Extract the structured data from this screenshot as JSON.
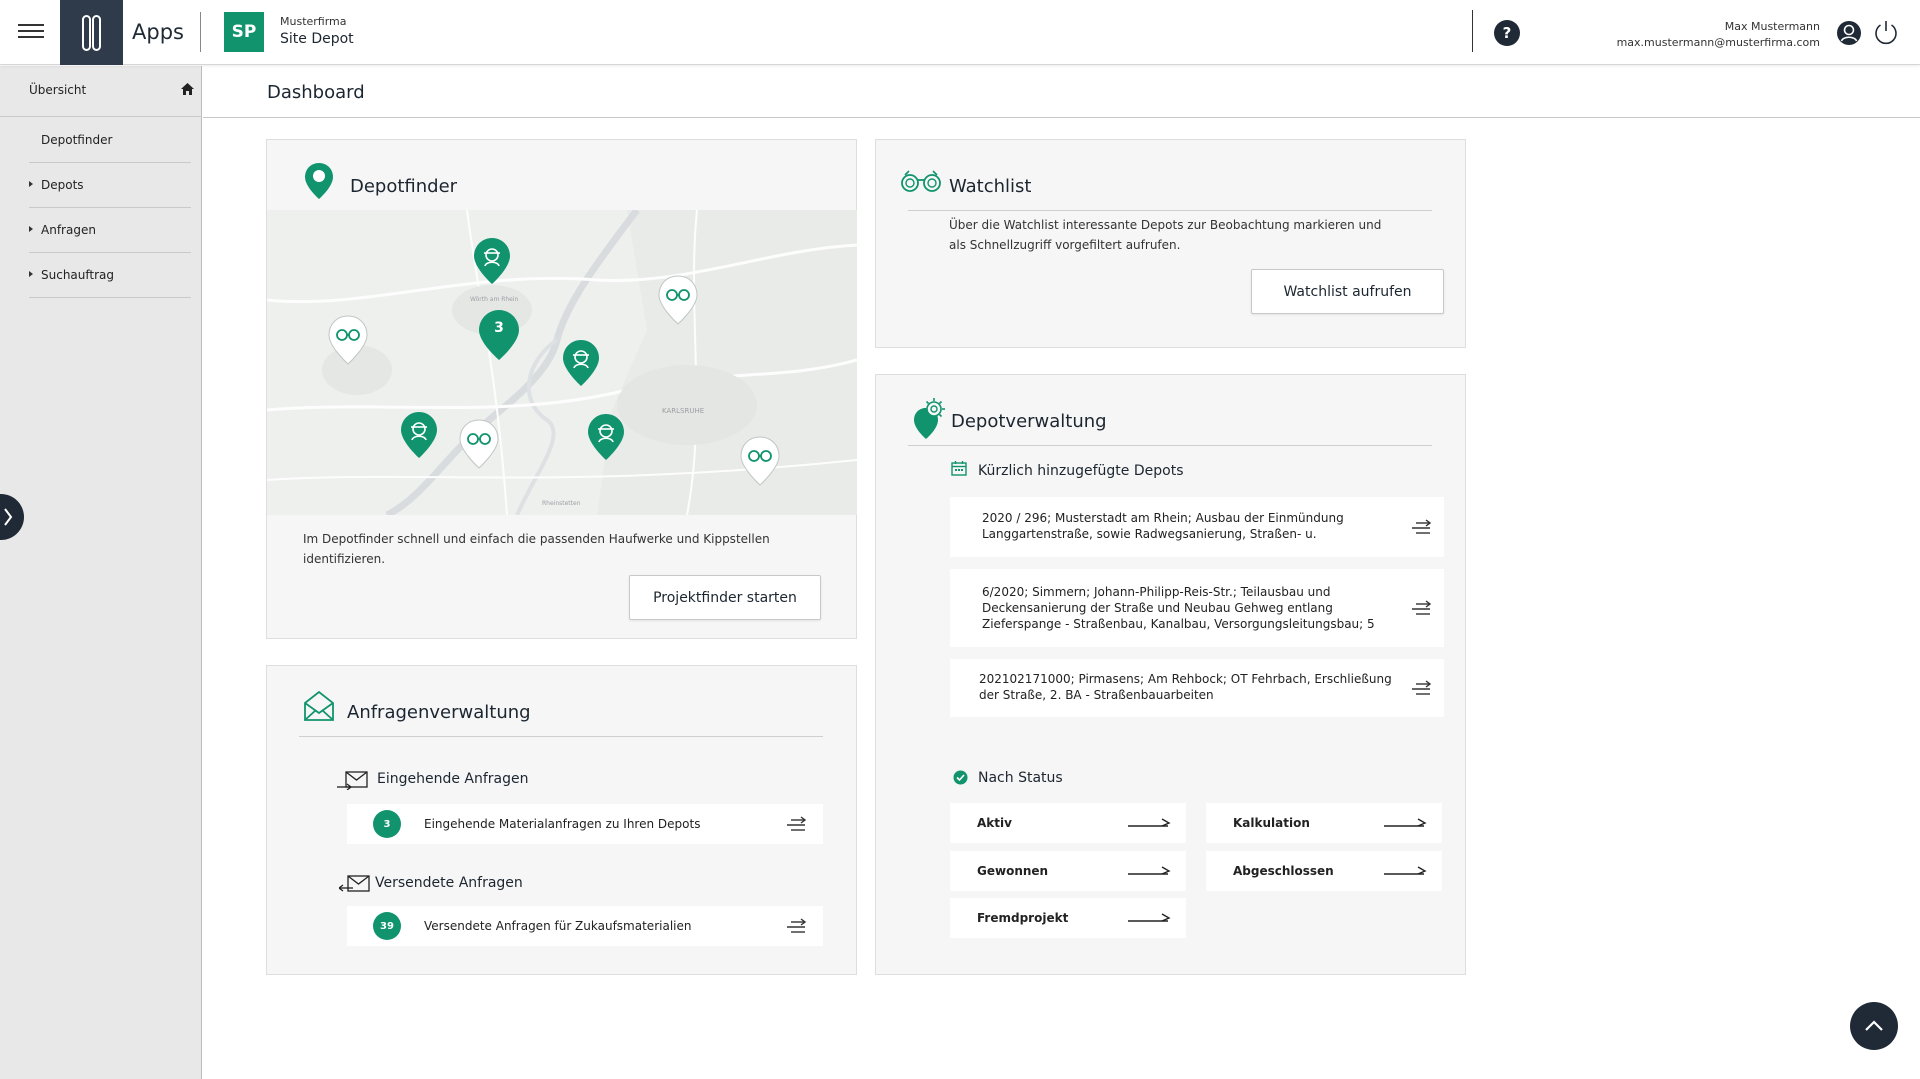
{
  "header": {
    "apps_label": "Apps",
    "app_badge": "SP",
    "firm_name": "Musterfirma",
    "site_name": "Site Depot",
    "help_label": "?",
    "user_name": "Max Mustermann",
    "user_email": "max.mustermann@musterfirma.com"
  },
  "sidebar": {
    "overview": "Übersicht",
    "items": [
      {
        "label": "Depotfinder",
        "expandable": false
      },
      {
        "label": "Depots",
        "expandable": true
      },
      {
        "label": "Anfragen",
        "expandable": true
      },
      {
        "label": "Suchauftrag",
        "expandable": true
      }
    ]
  },
  "page": {
    "title": "Dashboard"
  },
  "depotfinder": {
    "title": "Depotfinder",
    "description": "Im Depotfinder schnell und einfach die passenden Haufwerke und Kippstellen identifizieren.",
    "button": "Projektfinder starten",
    "cluster_count": "3"
  },
  "watchlist": {
    "title": "Watchlist",
    "description": "Über die Watchlist interessante Depots zur Beobachtung markieren und als Schnellzugriff vorgefiltert aufrufen.",
    "button": "Watchlist aufrufen"
  },
  "anfragen": {
    "title": "Anfragenverwaltung",
    "incoming_head": "Eingehende Anfragen",
    "incoming_count": "3",
    "incoming_label": "Eingehende Materialanfragen zu Ihren Depots",
    "sent_head": "Versendete Anfragen",
    "sent_count": "39",
    "sent_label": "Versendete Anfragen für Zukaufsmaterialien"
  },
  "depotverwaltung": {
    "title": "Depotverwaltung",
    "recent_head": "Kürzlich hinzugefügte Depots",
    "recent": [
      "2020 / 296; Musterstadt am Rhein; Ausbau der Einmündung Langgartenstraße, sowie Radwegsanierung, Straßen- u.",
      "6/2020; Simmern; Johann-Philipp-Reis-Str.; Teilausbau und Deckensanierung der Straße und Neubau Gehweg entlang Zieferspange - Straßenbau, Kanalbau, Versorgungsleitungsbau; 5",
      "202102171000; Pirmasens; Am Rehbock; OT Fehrbach, Erschließung der Straße, 2. BA - Straßenbauarbeiten"
    ],
    "status_head": "Nach Status",
    "status": [
      "Aktiv",
      "Kalkulation",
      "Gewonnen",
      "Abgeschlossen",
      "Fremdprojekt"
    ]
  },
  "map_labels": {
    "karlsruhe": "KARLSRUHE",
    "woerth": "Wörth am Rhein",
    "rheinstetten": "Rheinstetten"
  },
  "colors": {
    "brand_green": "#11946d",
    "dark_navy": "#1f2a36"
  }
}
